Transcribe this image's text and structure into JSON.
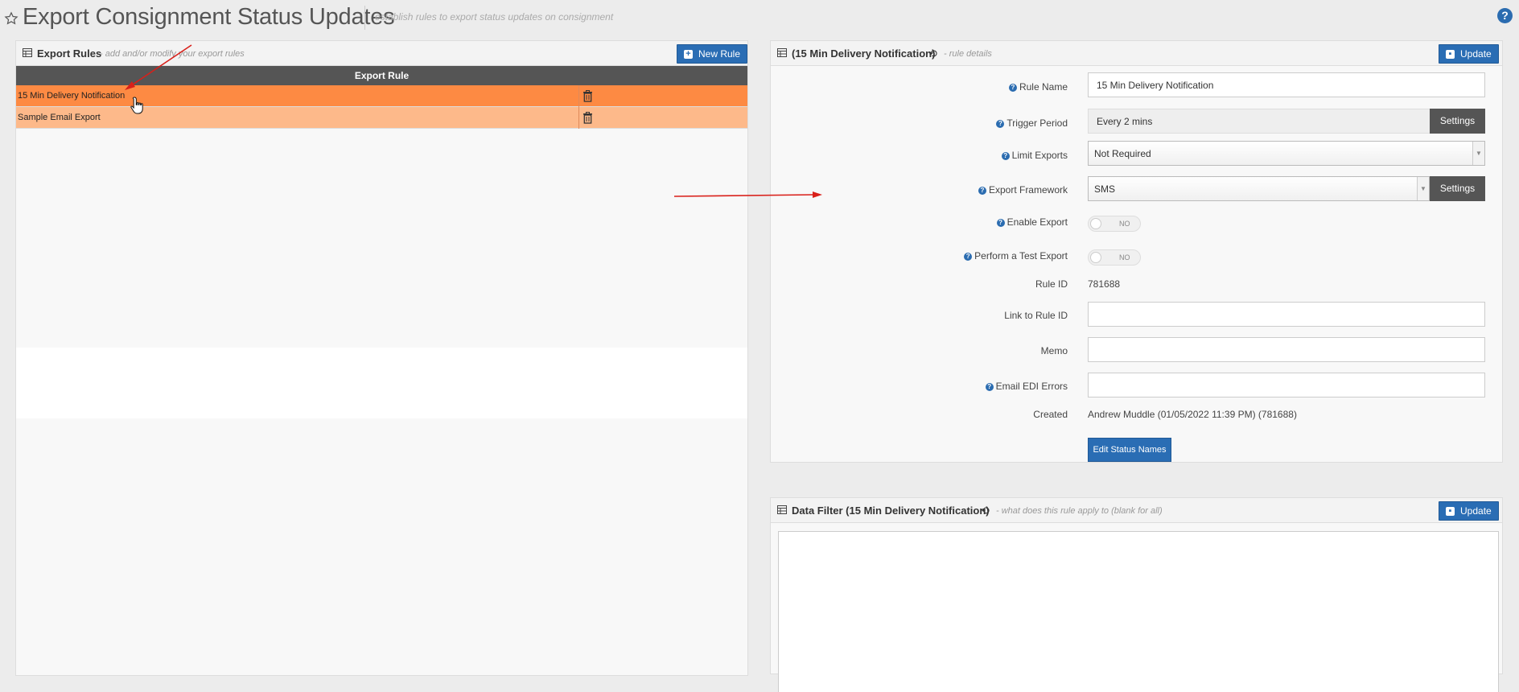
{
  "header": {
    "title": "Export Consignment Status Updates",
    "subtitle": "establish rules to export status updates on consignment"
  },
  "rules_panel": {
    "title": "Export Rules",
    "subtitle": "- add and/or modify your export rules",
    "new_rule_label": "New Rule",
    "table": {
      "column_header": "Export Rule",
      "rows": [
        {
          "name": "15 Min Delivery Notification",
          "selected": true
        },
        {
          "name": "Sample Email Export",
          "selected": false
        }
      ]
    }
  },
  "details_panel": {
    "title": "(15 Min Delivery Notification)",
    "subtitle": "- rule details",
    "update_label": "Update",
    "fields": {
      "rule_name_label": "Rule Name",
      "rule_name_value": "15 Min Delivery Notification",
      "trigger_period_label": "Trigger Period",
      "trigger_period_value": "Every 2 mins",
      "settings_label": "Settings",
      "limit_exports_label": "Limit Exports",
      "limit_exports_value": "Not Required",
      "export_framework_label": "Export Framework",
      "export_framework_value": "SMS",
      "enable_export_label": "Enable Export",
      "enable_export_value": "NO",
      "test_export_label": "Perform a Test Export",
      "test_export_value": "NO",
      "rule_id_label": "Rule ID",
      "rule_id_value": "781688",
      "link_rule_label": "Link to Rule ID",
      "link_rule_value": "",
      "memo_label": "Memo",
      "memo_value": "",
      "email_edi_label": "Email EDI Errors",
      "email_edi_value": "",
      "created_label": "Created",
      "created_value": "Andrew Muddle (01/05/2022 11:39 PM) (781688)"
    },
    "edit_status_label": "Edit Status Names"
  },
  "filter_panel": {
    "title": "Data Filter (15 Min Delivery Notification)",
    "subtitle": "- what does this rule apply to (blank for all)",
    "update_label": "Update"
  },
  "icons": {
    "help": "question-circle-icon",
    "star": "star-icon",
    "grid": "table-icon",
    "history": "history-icon",
    "trash": "trash-icon",
    "save": "save-icon",
    "plus": "plus-icon"
  },
  "colors": {
    "accent_blue": "#2a6db4",
    "selected_row": "#fd8a43",
    "row_alt": "#fdb98a",
    "annotation_red": "#d9201a"
  }
}
